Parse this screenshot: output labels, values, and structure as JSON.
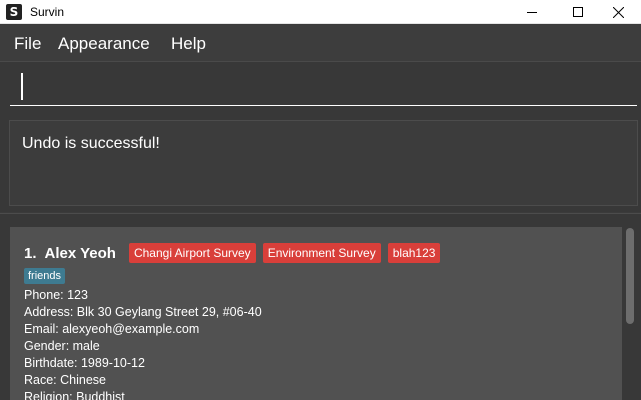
{
  "window": {
    "title": "Survin",
    "icon_glyph": "S",
    "controls": [
      "minimize-icon",
      "maximize-icon",
      "close-icon"
    ]
  },
  "menu": {
    "file": "File",
    "appearance": "Appearance",
    "help": "Help"
  },
  "command": {
    "value": "",
    "placeholder": ""
  },
  "result": {
    "message": "Undo is successful!"
  },
  "persons": [
    {
      "index": "1.",
      "name": "Alex Yeoh",
      "surveys": [
        "Changi Airport Survey",
        "Environment Survey",
        "blah123"
      ],
      "tags": [
        "friends"
      ],
      "phone": "Phone: 123",
      "address": "Address: Blk 30 Geylang Street 29, #06-40",
      "email": "Email: alexyeoh@example.com",
      "gender": "Gender: male",
      "birthdate": "Birthdate: 1989-10-12",
      "race": "Race: Chinese",
      "religion": "Religion: Buddhist"
    }
  ],
  "colors": {
    "background": "#3b3b3b",
    "card": "#515151",
    "survey_tag": "#d93f3a",
    "group_tag": "#3e7b91"
  }
}
